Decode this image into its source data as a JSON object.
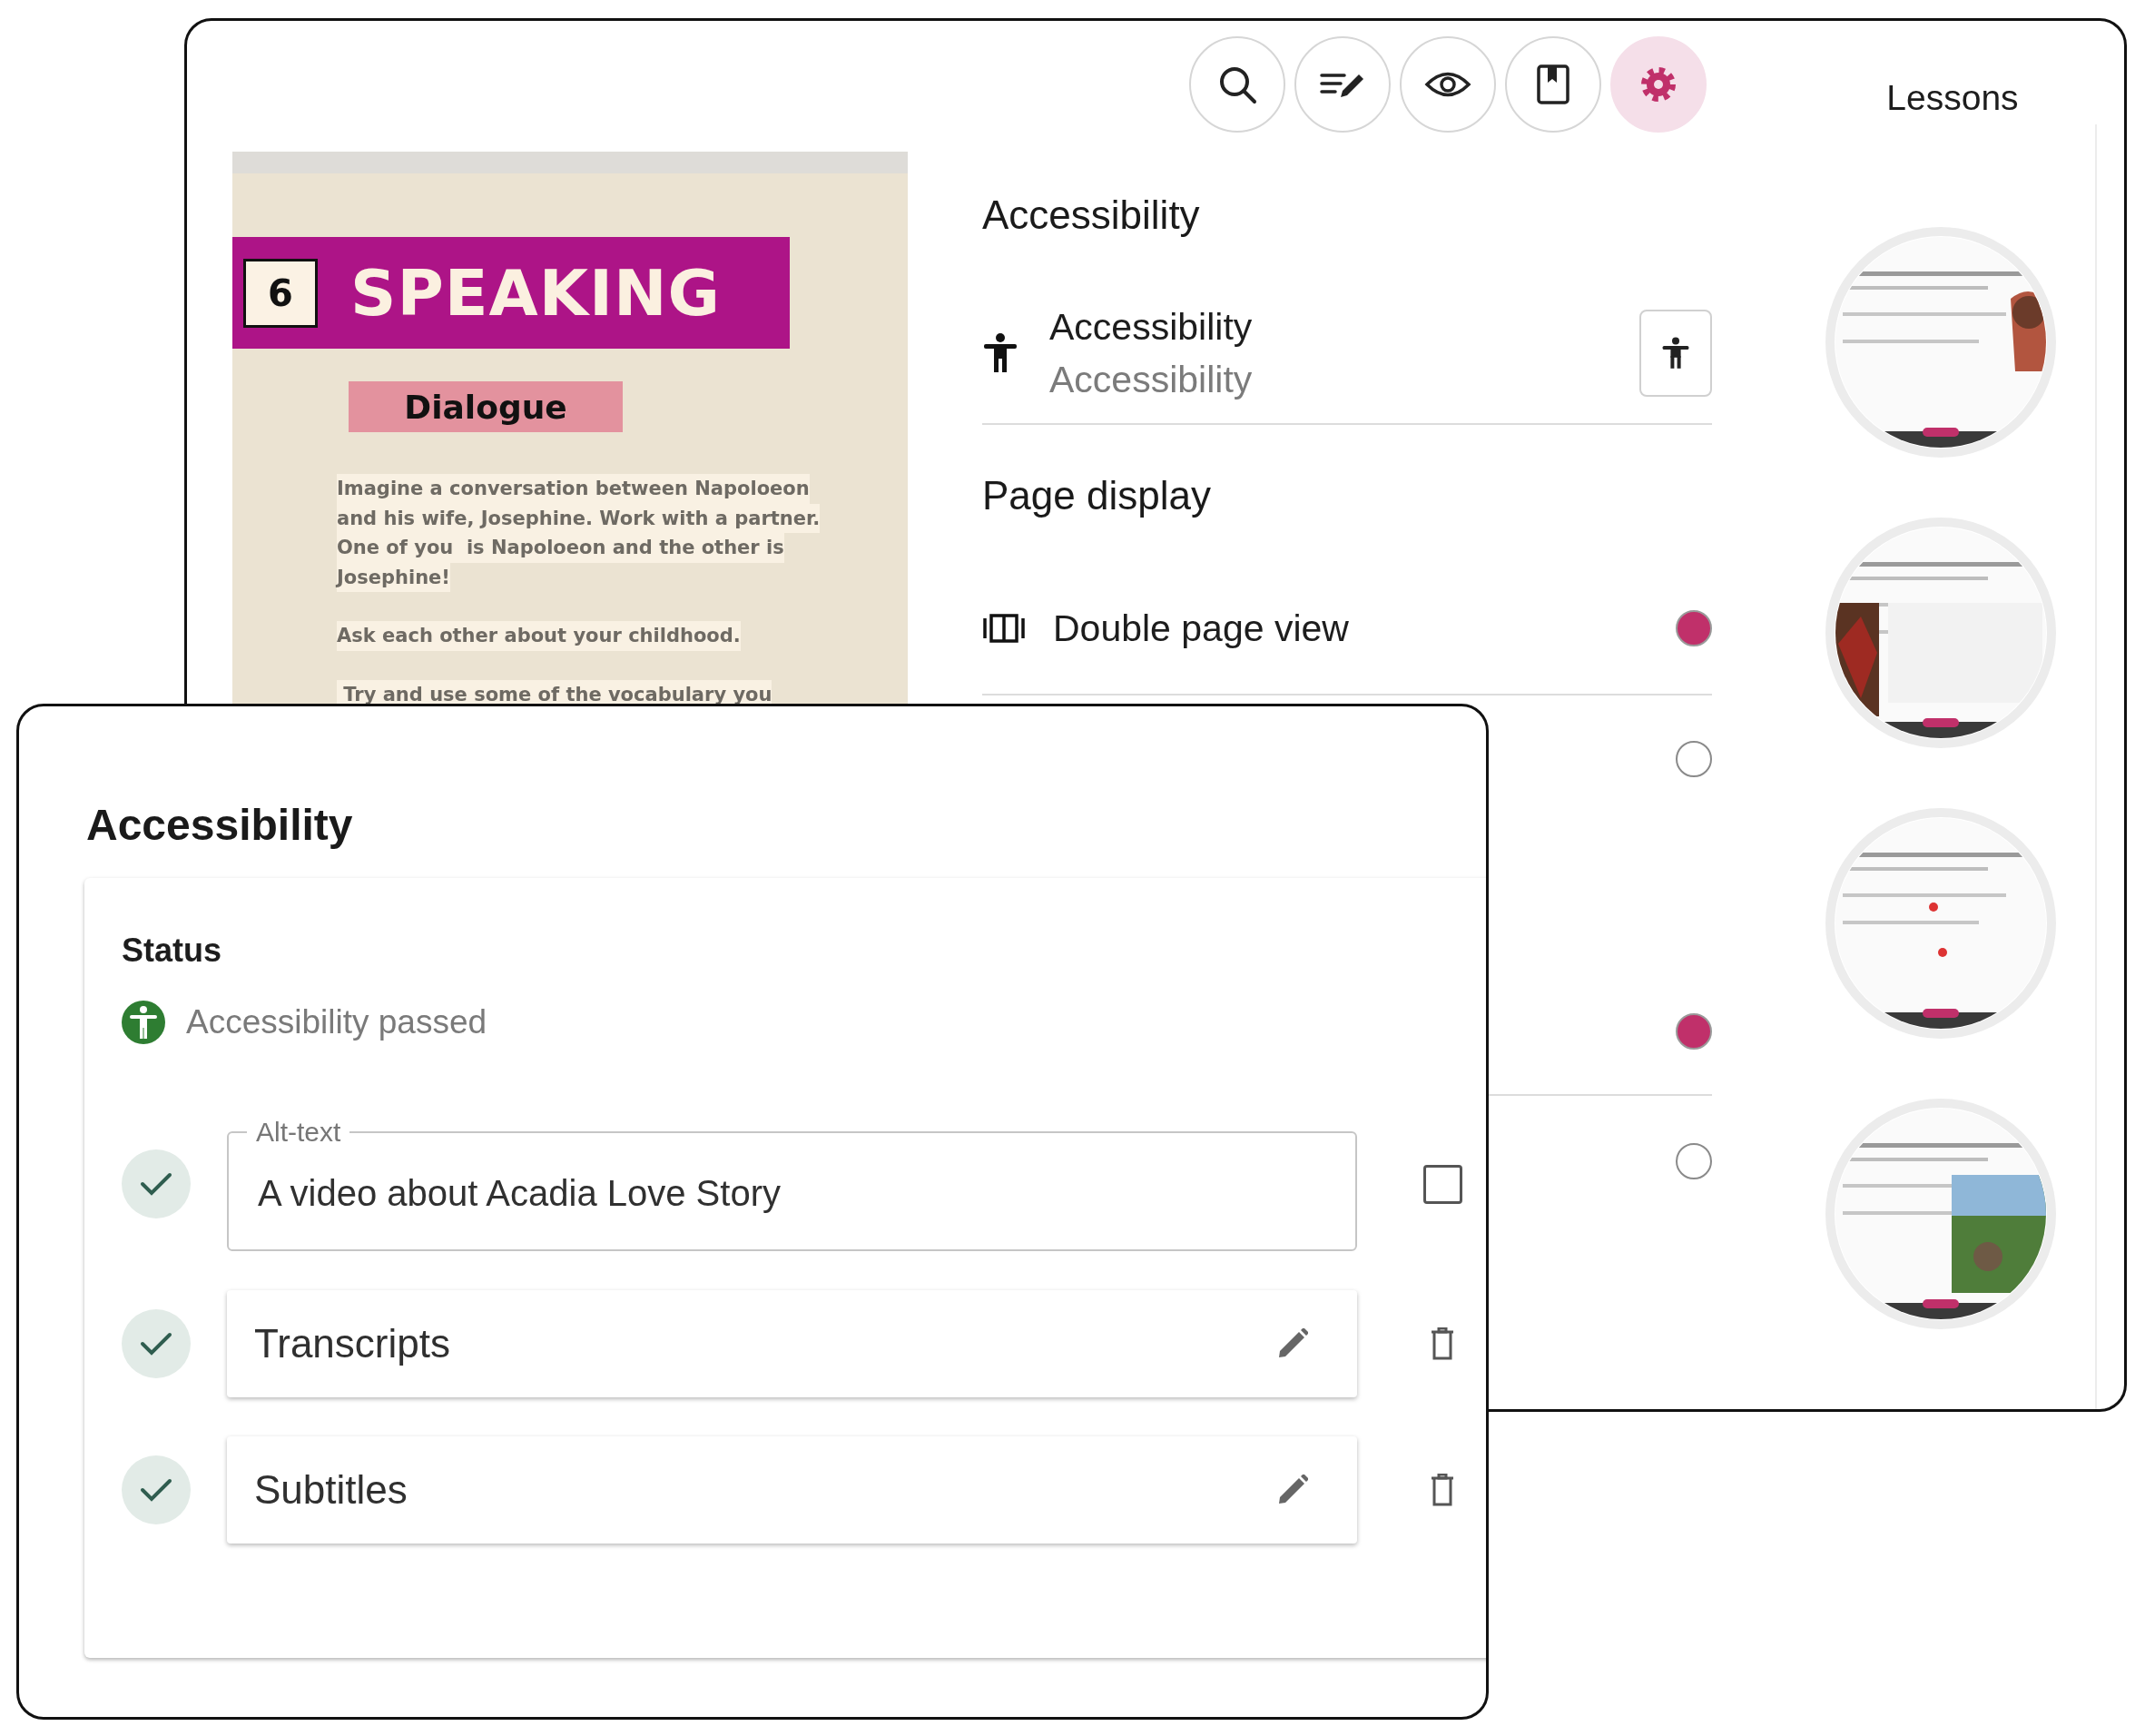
{
  "main_window": {
    "toolbar": [
      {
        "kind": "search",
        "selected": false
      },
      {
        "kind": "annotate",
        "selected": false
      },
      {
        "kind": "view",
        "selected": false
      },
      {
        "kind": "bookmark",
        "selected": false
      },
      {
        "kind": "settings",
        "selected": true
      }
    ],
    "lessons_label": "Lessons",
    "page_preview": {
      "number": "6",
      "title": "SPEAKING",
      "subtitle": "Dialogue",
      "paragraphs": [
        [
          "Imagine a conversation between Napoloeon",
          "and his wife, Josephine. Work with a partner.",
          "One of you  is Napoloeon and the other is",
          "Josephine!"
        ],
        [
          "Ask each other about your childhood."
        ],
        [
          " Try and use some of the vocabulary you"
        ]
      ]
    },
    "settings_panel": {
      "accessibility_heading": "Accessibility",
      "accessibility_row": {
        "title": "Accessibility",
        "subtitle": "Accessibility"
      },
      "page_display_heading": "Page display",
      "options": [
        {
          "label": "Double page view",
          "on": true
        },
        {
          "on": false
        },
        {
          "on": true
        },
        {
          "on": false
        }
      ]
    }
  },
  "accessibility_dialog": {
    "title": "Accessibility",
    "status_label": "Status",
    "status": "Accessibility passed",
    "items": [
      {
        "kind": "field",
        "label": "Alt-text",
        "value": "A video about Acadia Love Story",
        "done": true,
        "checked": false
      },
      {
        "kind": "card",
        "label": "Transcripts",
        "done": true
      },
      {
        "kind": "card",
        "label": "Subtitles",
        "done": true
      }
    ]
  }
}
